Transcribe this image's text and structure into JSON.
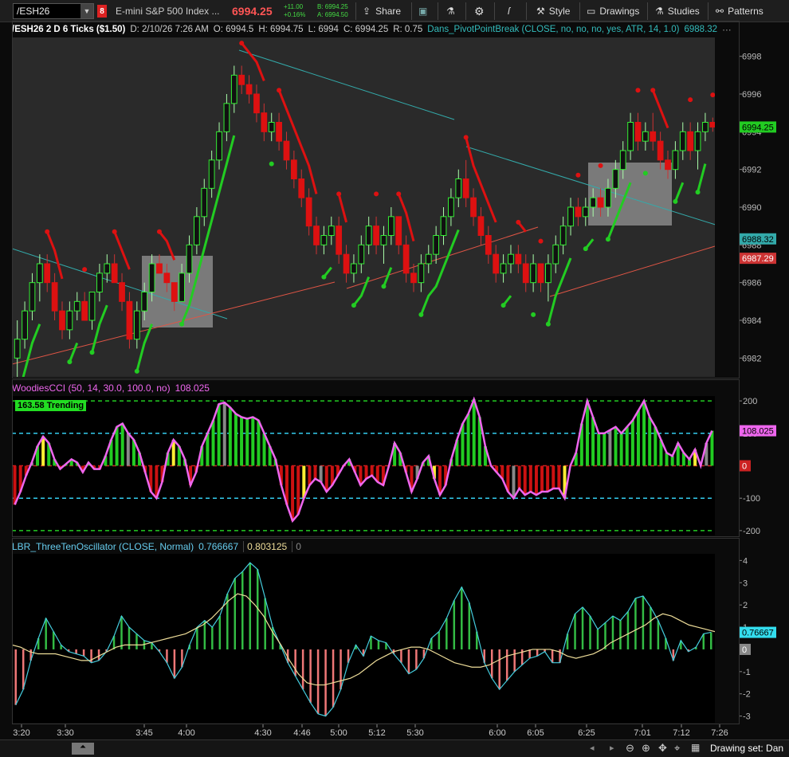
{
  "toolbar": {
    "symbol": "/ESH26",
    "description": "E-mini S&P 500 Index ...",
    "last_price": "6994.25",
    "net_change": "+11.00",
    "pct_change": "+0.16%",
    "bid": "B: 6994.25",
    "ask": "A: 6994.50",
    "share_label": "Share",
    "style_label": "Style",
    "drawings_label": "Drawings",
    "studies_label": "Studies",
    "patterns_label": "Patterns",
    "icons": [
      "share-icon",
      "flask-icon",
      "gear-icon",
      "pen-icon",
      "style-icon",
      "drawings-icon",
      "studies-icon",
      "patterns-icon"
    ]
  },
  "price_pane": {
    "chart_title": "/ESH26 2 D 6 Ticks ($1.50)",
    "date": "D: 2/10/26 7:26 AM",
    "open": "O: 6994.5",
    "high": "H: 6994.75",
    "low": "L: 6994",
    "close": "C: 6994.25",
    "range": "R: 0.75",
    "study": "Dans_PivotPointBreak (CLOSE, no, no, no, yes, ATR, 14, 1.0)",
    "study_value": "6988.32",
    "ticks": [
      "6998",
      "6996",
      "6994",
      "6992",
      "6990",
      "6988",
      "6986",
      "6984",
      "6982"
    ],
    "last_label": "6994.25",
    "teal_label": "6988.32",
    "red_label": "6987.29"
  },
  "cci_pane": {
    "title": "WoodiesCCI (50, 14, 30.0, 100.0, no)",
    "value": "108.025",
    "badge": "163.58 Trending",
    "ticks": [
      "200",
      "100",
      "0",
      "-100",
      "-200"
    ],
    "value_label": "108.025",
    "zero_label": "0"
  },
  "osc_pane": {
    "title": "LBR_ThreeTenOscillator (CLOSE, Normal)",
    "value1": "0.766667",
    "value2": "0.803125",
    "value3": "0",
    "ticks": [
      "4",
      "3",
      "2",
      "1",
      "0",
      "-1",
      "-2",
      "-3"
    ],
    "value_label": "0.76667",
    "zero_label": "0"
  },
  "time_axis": [
    "3:20",
    "3:30",
    "3:45",
    "4:00",
    "4:30",
    "4:46",
    "5:00",
    "5:12",
    "5:30",
    "6:00",
    "6:05",
    "6:25",
    "7:01",
    "7:12",
    "7:26"
  ],
  "bottom_bar": {
    "drawing_set": "Drawing set: Dan",
    "icons": [
      "scroll-up-icon",
      "zoom-out-icon",
      "zoom-in-icon",
      "crosshair-icon",
      "zoom-fit-icon",
      "calendar-icon"
    ]
  },
  "colors": {
    "up": "#22cc22",
    "down": "#dd1111",
    "teal": "#33aaaa",
    "salmon": "#e05545",
    "cci_line": "#ee66ee",
    "osc_up": "#33bb44",
    "osc_dn": "#ee7777"
  },
  "chart_data": [
    {
      "type": "candlestick",
      "title": "/ESH26 2 D 6 Ticks ($1.50)",
      "ylim": [
        6981,
        6999
      ],
      "ohlc": [
        [
          6982.0,
          6984.0,
          6981.0,
          6983.0
        ],
        [
          6983.0,
          6985.0,
          6982.5,
          6984.5
        ],
        [
          6984.5,
          6986.5,
          6984.0,
          6986.0
        ],
        [
          6986.0,
          6987.5,
          6985.0,
          6987.0
        ],
        [
          6987.0,
          6987.5,
          6985.5,
          6986.0
        ],
        [
          6986.0,
          6986.5,
          6984.0,
          6984.5
        ],
        [
          6984.5,
          6985.0,
          6983.0,
          6983.5
        ],
        [
          6983.5,
          6985.0,
          6983.0,
          6984.5
        ],
        [
          6984.5,
          6985.5,
          6984.0,
          6985.0
        ],
        [
          6985.0,
          6985.5,
          6984.0,
          6984.0
        ],
        [
          6984.0,
          6985.5,
          6983.5,
          6985.5
        ],
        [
          6985.5,
          6987.0,
          6985.0,
          6986.5
        ],
        [
          6986.5,
          6987.5,
          6986.0,
          6987.0
        ],
        [
          6987.0,
          6987.5,
          6986.0,
          6986.0
        ],
        [
          6986.0,
          6986.5,
          6984.5,
          6985.0
        ],
        [
          6985.0,
          6985.5,
          6982.5,
          6983.0
        ],
        [
          6983.0,
          6985.0,
          6982.5,
          6984.5
        ],
        [
          6984.5,
          6986.0,
          6984.0,
          6985.5
        ],
        [
          6985.5,
          6987.5,
          6985.0,
          6987.0
        ],
        [
          6987.0,
          6987.5,
          6986.5,
          6986.5
        ],
        [
          6986.5,
          6987.0,
          6985.5,
          6986.0
        ],
        [
          6986.0,
          6986.0,
          6984.5,
          6985.0
        ],
        [
          6985.0,
          6987.0,
          6985.0,
          6986.5
        ],
        [
          6986.5,
          6988.5,
          6986.0,
          6988.0
        ],
        [
          6988.0,
          6990.0,
          6987.5,
          6989.5
        ],
        [
          6989.5,
          6991.5,
          6989.0,
          6991.0
        ],
        [
          6991.0,
          6993.0,
          6990.5,
          6992.5
        ],
        [
          6992.5,
          6994.5,
          6992.0,
          6994.0
        ],
        [
          6994.0,
          6996.0,
          6993.5,
          6995.5
        ],
        [
          6995.5,
          6997.5,
          6995.0,
          6997.0
        ],
        [
          6997.0,
          6997.5,
          6996.0,
          6996.5
        ],
        [
          6996.5,
          6997.0,
          6995.5,
          6996.0
        ],
        [
          6996.0,
          6996.5,
          6994.5,
          6995.0
        ],
        [
          6995.0,
          6995.5,
          6993.5,
          6994.0
        ],
        [
          6994.0,
          6995.0,
          6993.5,
          6994.5
        ],
        [
          6994.5,
          6995.0,
          6993.0,
          6993.5
        ],
        [
          6993.5,
          6994.0,
          6992.0,
          6992.5
        ],
        [
          6992.5,
          6993.0,
          6991.0,
          6991.5
        ],
        [
          6991.5,
          6992.0,
          6990.0,
          6990.5
        ],
        [
          6990.5,
          6991.0,
          6988.5,
          6989.0
        ],
        [
          6989.0,
          6989.5,
          6987.5,
          6988.0
        ],
        [
          6988.0,
          6989.0,
          6987.5,
          6988.5
        ],
        [
          6988.5,
          6989.5,
          6988.0,
          6989.0
        ],
        [
          6989.0,
          6989.5,
          6987.0,
          6987.5
        ],
        [
          6987.5,
          6988.0,
          6986.0,
          6986.5
        ],
        [
          6986.5,
          6987.5,
          6986.0,
          6987.0
        ],
        [
          6987.0,
          6988.5,
          6986.5,
          6988.0
        ],
        [
          6988.0,
          6989.5,
          6987.5,
          6989.0
        ],
        [
          6989.0,
          6989.5,
          6987.5,
          6988.0
        ],
        [
          6988.0,
          6989.0,
          6987.0,
          6988.5
        ],
        [
          6988.5,
          6990.0,
          6988.0,
          6989.5
        ],
        [
          6989.5,
          6989.5,
          6987.5,
          6988.0
        ],
        [
          6988.0,
          6988.5,
          6986.0,
          6986.5
        ],
        [
          6986.5,
          6987.0,
          6985.5,
          6986.0
        ],
        [
          6986.0,
          6987.5,
          6985.5,
          6987.0
        ],
        [
          6987.0,
          6988.0,
          6986.5,
          6987.5
        ],
        [
          6987.5,
          6989.0,
          6987.0,
          6988.5
        ],
        [
          6988.5,
          6990.0,
          6988.0,
          6989.5
        ],
        [
          6989.5,
          6991.0,
          6989.0,
          6990.5
        ],
        [
          6990.5,
          6992.0,
          6990.0,
          6991.5
        ],
        [
          6991.5,
          6992.5,
          6990.0,
          6990.5
        ],
        [
          6990.5,
          6991.0,
          6989.0,
          6989.5
        ],
        [
          6989.5,
          6990.0,
          6988.0,
          6988.5
        ],
        [
          6988.5,
          6989.0,
          6987.0,
          6987.5
        ],
        [
          6987.5,
          6988.0,
          6986.0,
          6986.5
        ],
        [
          6986.5,
          6987.5,
          6986.0,
          6987.0
        ],
        [
          6987.0,
          6988.0,
          6986.5,
          6987.5
        ],
        [
          6987.5,
          6988.0,
          6986.5,
          6987.0
        ],
        [
          6987.0,
          6987.5,
          6985.5,
          6986.0
        ],
        [
          6986.0,
          6987.5,
          6985.5,
          6987.0
        ],
        [
          6987.0,
          6987.0,
          6985.5,
          6986.0
        ],
        [
          6986.0,
          6987.5,
          6985.0,
          6987.0
        ],
        [
          6987.0,
          6988.5,
          6986.5,
          6988.0
        ],
        [
          6988.0,
          6989.5,
          6987.5,
          6989.0
        ],
        [
          6989.0,
          6990.5,
          6988.5,
          6990.0
        ],
        [
          6990.0,
          6990.5,
          6989.0,
          6989.5
        ],
        [
          6989.5,
          6990.5,
          6989.0,
          6990.0
        ],
        [
          6990.0,
          6991.0,
          6989.5,
          6990.5
        ],
        [
          6990.5,
          6991.0,
          6989.5,
          6990.0
        ],
        [
          6990.0,
          6991.5,
          6989.5,
          6991.0
        ],
        [
          6991.0,
          6992.5,
          6990.5,
          6992.0
        ],
        [
          6992.0,
          6993.5,
          6991.5,
          6993.0
        ],
        [
          6993.0,
          6995.0,
          6992.5,
          6994.5
        ],
        [
          6994.5,
          6995.0,
          6993.0,
          6993.5
        ],
        [
          6993.5,
          6994.5,
          6993.0,
          6994.0
        ],
        [
          6994.0,
          6995.0,
          6993.0,
          6993.5
        ],
        [
          6993.5,
          6994.0,
          6992.0,
          6992.5
        ],
        [
          6992.5,
          6993.0,
          6991.5,
          6992.0
        ],
        [
          6992.0,
          6993.5,
          6991.5,
          6993.0
        ],
        [
          6993.0,
          6994.5,
          6992.5,
          6994.0
        ],
        [
          6994.0,
          6994.5,
          6992.5,
          6993.0
        ],
        [
          6993.0,
          6994.5,
          6992.0,
          6994.0
        ],
        [
          6994.0,
          6995.0,
          6993.5,
          6994.5
        ],
        [
          6994.5,
          6994.75,
          6994.0,
          6994.25
        ]
      ]
    },
    {
      "type": "bar",
      "title": "WoodiesCCI (50, 14, 30.0, 100.0, no)",
      "ylim": [
        -215,
        215
      ],
      "values": [
        -120,
        -80,
        -30,
        10,
        60,
        90,
        70,
        20,
        -10,
        5,
        20,
        10,
        -20,
        10,
        -10,
        -10,
        30,
        80,
        120,
        130,
        100,
        80,
        40,
        -20,
        -80,
        -100,
        -50,
        40,
        80,
        60,
        20,
        -60,
        -20,
        60,
        100,
        140,
        190,
        195,
        180,
        160,
        150,
        145,
        150,
        140,
        100,
        60,
        20,
        -60,
        -120,
        -170,
        -150,
        -100,
        -60,
        -40,
        -50,
        -80,
        -60,
        -30,
        0,
        20,
        -20,
        -60,
        -40,
        -30,
        -50,
        -60,
        0,
        70,
        40,
        -20,
        -80,
        -40,
        10,
        30,
        -40,
        -90,
        -60,
        20,
        80,
        130,
        160,
        205,
        150,
        60,
        0,
        -20,
        -40,
        -80,
        -100,
        -70,
        -90,
        -80,
        -90,
        -80,
        -80,
        -70,
        -70,
        -100,
        0,
        40,
        130,
        200,
        150,
        100,
        100,
        110,
        120,
        100,
        120,
        140,
        170,
        200,
        150,
        120,
        80,
        40,
        30,
        70,
        40,
        20,
        50,
        0,
        70,
        108
      ]
    },
    {
      "type": "bar",
      "title": "LBR_ThreeTenOscillator (CLOSE, Normal)",
      "ylim": [
        -3.3,
        4.3
      ],
      "values": [
        -2.5,
        -1.8,
        -0.5,
        0.5,
        1.4,
        0.8,
        0.2,
        -0.1,
        -0.2,
        -0.3,
        -0.6,
        -0.5,
        -0.1,
        0.6,
        1.5,
        1.0,
        0.7,
        0.4,
        0.3,
        -0.1,
        -0.6,
        -1.3,
        -0.8,
        0.2,
        1.0,
        1.3,
        1.0,
        1.5,
        2.5,
        3.2,
        3.5,
        3.9,
        3.6,
        2.3,
        1.0,
        0.2,
        -0.6,
        -1.2,
        -1.8,
        -2.4,
        -2.9,
        -3.0,
        -2.6,
        -1.8,
        -0.6,
        0.2,
        -0.3,
        0.6,
        0.4,
        0.3,
        -0.2,
        -0.6,
        -1.1,
        -0.9,
        -0.4,
        0.5,
        0.8,
        1.4,
        2.2,
        2.8,
        2.1,
        0.8,
        -0.6,
        -1.3,
        -1.8,
        -1.4,
        -1.0,
        -0.7,
        -0.4,
        -0.3,
        -0.1,
        -0.6,
        -0.6,
        0.7,
        1.6,
        1.9,
        1.5,
        0.9,
        1.2,
        1.5,
        1.3,
        1.7,
        2.3,
        2.4,
        1.9,
        1.3,
        0.5,
        -0.5,
        0.4,
        -0.1,
        0.1,
        0.7,
        0.77
      ],
      "signal": [
        0.2,
        0.1,
        -0.1,
        -0.2,
        -0.2,
        -0.2,
        -0.3,
        -0.4,
        -0.5,
        -0.5,
        -0.3,
        -0.1,
        0.1,
        0.2,
        0.2,
        0.2,
        0.3,
        0.4,
        0.5,
        0.6,
        0.7,
        0.9,
        1.1,
        1.4,
        1.8,
        2.2,
        2.5,
        2.4,
        2.0,
        1.5,
        0.8,
        0.2,
        -0.5,
        -1.1,
        -1.5,
        -1.6,
        -1.6,
        -1.5,
        -1.4,
        -1.3,
        -1.1,
        -0.8,
        -0.5,
        -0.3,
        -0.1,
        0.0,
        0.1,
        0.1,
        0.0,
        -0.2,
        -0.4,
        -0.6,
        -0.7,
        -0.8,
        -0.8,
        -0.7,
        -0.5,
        -0.3,
        -0.2,
        -0.1,
        0.0,
        0.0,
        0.0,
        -0.1,
        -0.3,
        -0.4,
        -0.3,
        -0.2,
        0.0,
        0.3,
        0.5,
        0.7,
        0.9,
        1.1,
        1.4,
        1.6,
        1.5,
        1.3,
        1.1,
        1.0,
        0.9,
        0.8
      ]
    }
  ]
}
